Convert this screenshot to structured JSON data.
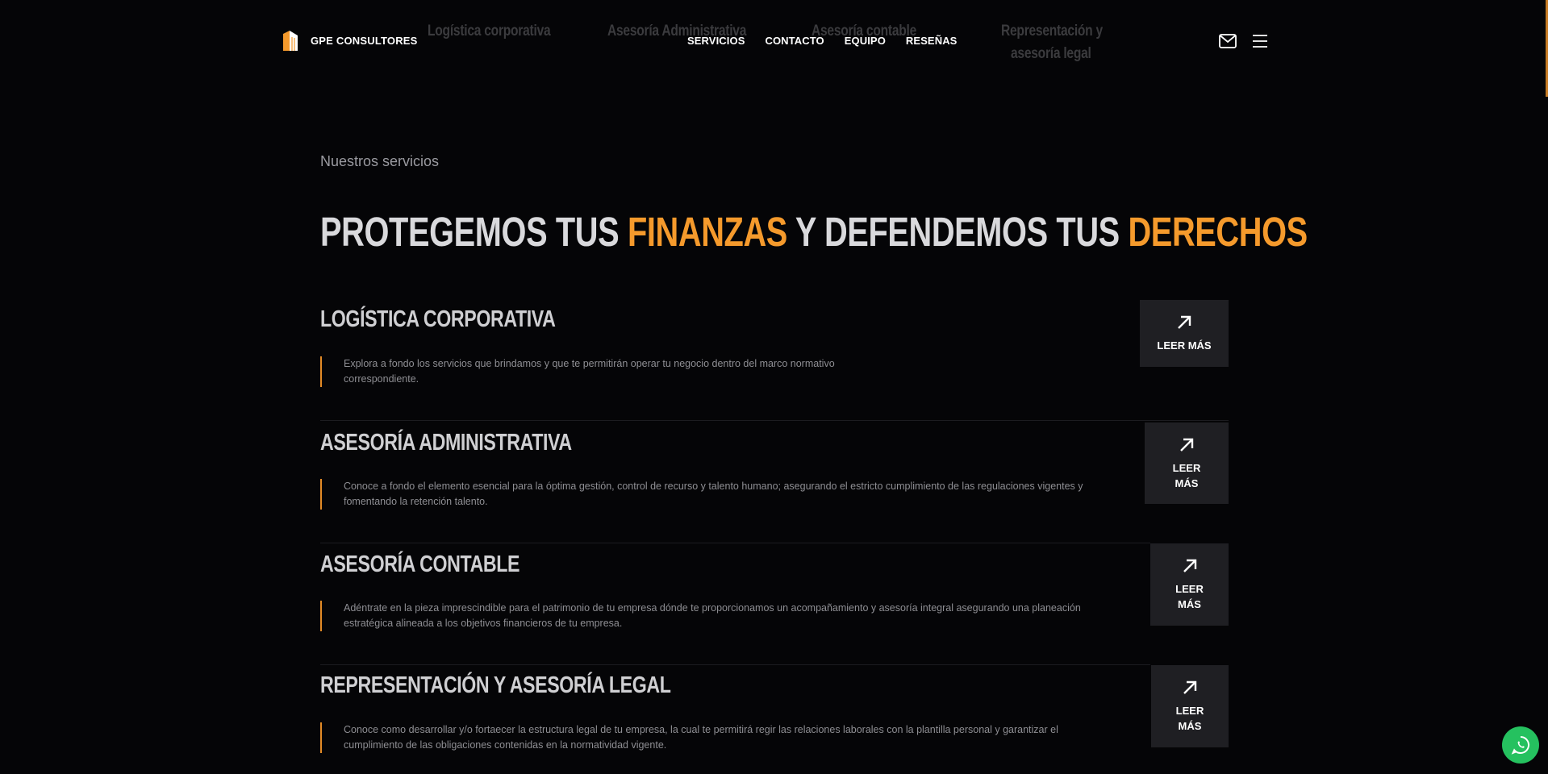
{
  "header": {
    "brand": "GPE CONSULTORES",
    "ghost_items": [
      "Logística corporativa",
      "Asesoría Administrativa",
      "Asesoría contable",
      "Representación y",
      "asesoría legal"
    ],
    "nav": [
      {
        "label": "SERVICIOS"
      },
      {
        "label": "CONTACTO"
      },
      {
        "label": "EQUIPO"
      },
      {
        "label": "RESEÑAS"
      }
    ],
    "icons": {
      "mail": "mail-icon",
      "menu": "hamburger-menu-icon"
    }
  },
  "hero": {
    "eyebrow": "Nuestros servicios",
    "headline": {
      "part1": "PROTEGEMOS TUS ",
      "accent1": "FINANZAS",
      "part2": " Y DEFENDEMOS TUS ",
      "accent2": "DERECHOS"
    }
  },
  "services": [
    {
      "title": "LOGÍSTICA CORPORATIVA",
      "description": "Explora a fondo los servicios que brindamos y que te permitirán operar tu negocio dentro del marco normativo correspondiente.",
      "cta": "LEER MÁS"
    },
    {
      "title": "ASESORÍA ADMINISTRATIVA",
      "description": "Conoce a fondo el elemento esencial para la óptima gestión, control de recurso y talento humano; asegurando el estricto cumplimiento de las regulaciones vigentes y fomentando la retención talento.",
      "cta_line1": "LEER",
      "cta_line2": "MÁS"
    },
    {
      "title": "ASESORÍA CONTABLE",
      "description": "Adéntrate en la pieza imprescindible para el patrimonio de tu empresa dónde te proporcionamos un acompañamiento y asesoría integral asegurando una planeación estratégica alineada a los objetivos financieros de tu empresa.",
      "cta_line1": "LEER",
      "cta_line2": "MÁS"
    },
    {
      "title": "REPRESENTACIÓN Y ASESORÍA LEGAL",
      "description": "Conoce como desarrollar y/o fortaecer la estructura legal de tu empresa, la cual te permitirá regir las relaciones laborales con la plantilla personal y garantizar el cumplimiento de las obligaciones contenidas en la normatividad vigente.",
      "cta_line1": "LEER",
      "cta_line2": "MÁS"
    }
  ],
  "colors": {
    "accent": "#f59a2c",
    "background": "#050507",
    "cta_bg": "#1f1f23",
    "whatsapp": "#25c15f"
  },
  "floating": {
    "whatsapp_icon": "whatsapp-icon"
  }
}
